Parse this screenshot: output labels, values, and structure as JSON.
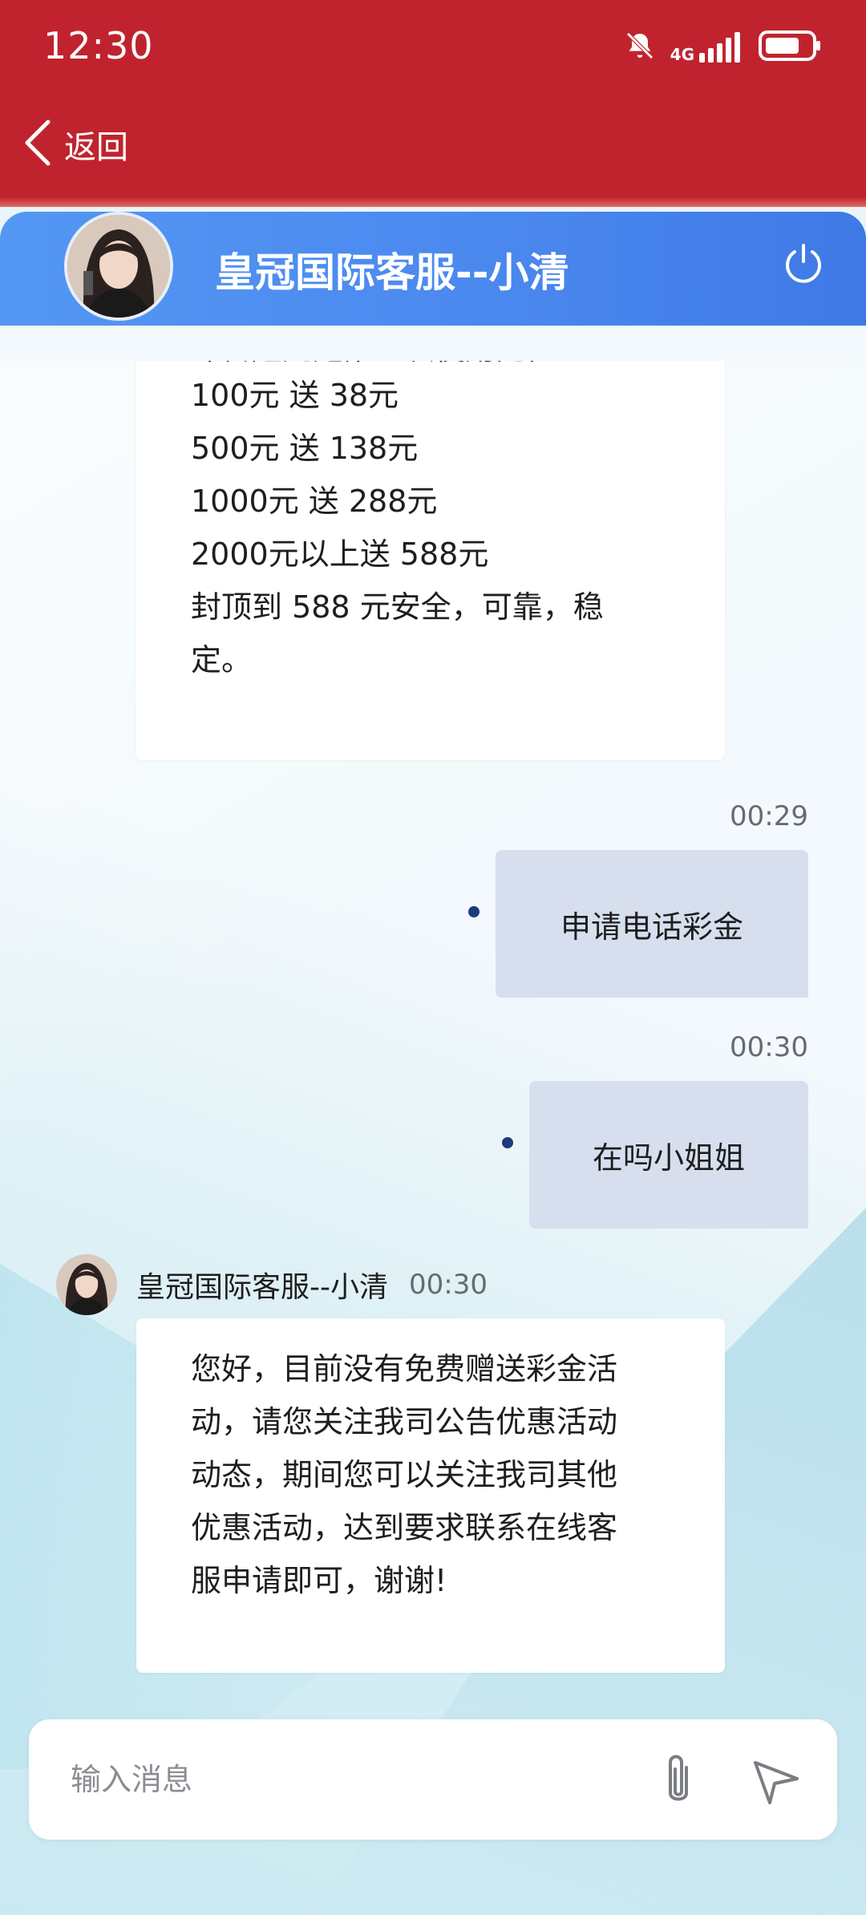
{
  "status_bar": {
    "time": "12:30",
    "network": "4G",
    "battery_level": 0.75
  },
  "nav": {
    "back_label": "返回"
  },
  "header": {
    "title": "皇冠国际客服--小清"
  },
  "messages": [
    {
      "side": "left",
      "partial_top_line": "即日起凡是第一次使用充值",
      "lines": [
        "100元 送 38元",
        "500元 送 138元",
        "1000元 送 288元",
        "2000元以上送 588元",
        "封顶到 588 元安全，可靠，稳",
        "定。"
      ]
    },
    {
      "side": "right",
      "time": "00:29",
      "text": "申请电话彩金"
    },
    {
      "side": "right",
      "time": "00:30",
      "text": "在吗小姐姐"
    },
    {
      "side": "left",
      "sender": "皇冠国际客服--小清",
      "time": "00:30",
      "lines": [
        "您好，目前没有免费赠送彩金活",
        "动，请您关注我司公告优惠活动",
        "动态，期间您可以关注我司其他",
        "优惠活动，达到要求联系在线客",
        "服申请即可，谢谢!"
      ]
    }
  ],
  "input": {
    "placeholder": "输入消息"
  },
  "icons": {
    "back": "chevron-left-icon",
    "power": "power-icon",
    "attach": "paperclip-icon",
    "send": "send-icon",
    "mute": "bell-off-icon",
    "signal": "signal-icon",
    "battery": "battery-icon"
  },
  "colors": {
    "primary_red": "#c0232e",
    "header_blue": "#4a87ee",
    "sent_bubble": "#d7dfef",
    "sent_dot": "#1f3a7a"
  }
}
